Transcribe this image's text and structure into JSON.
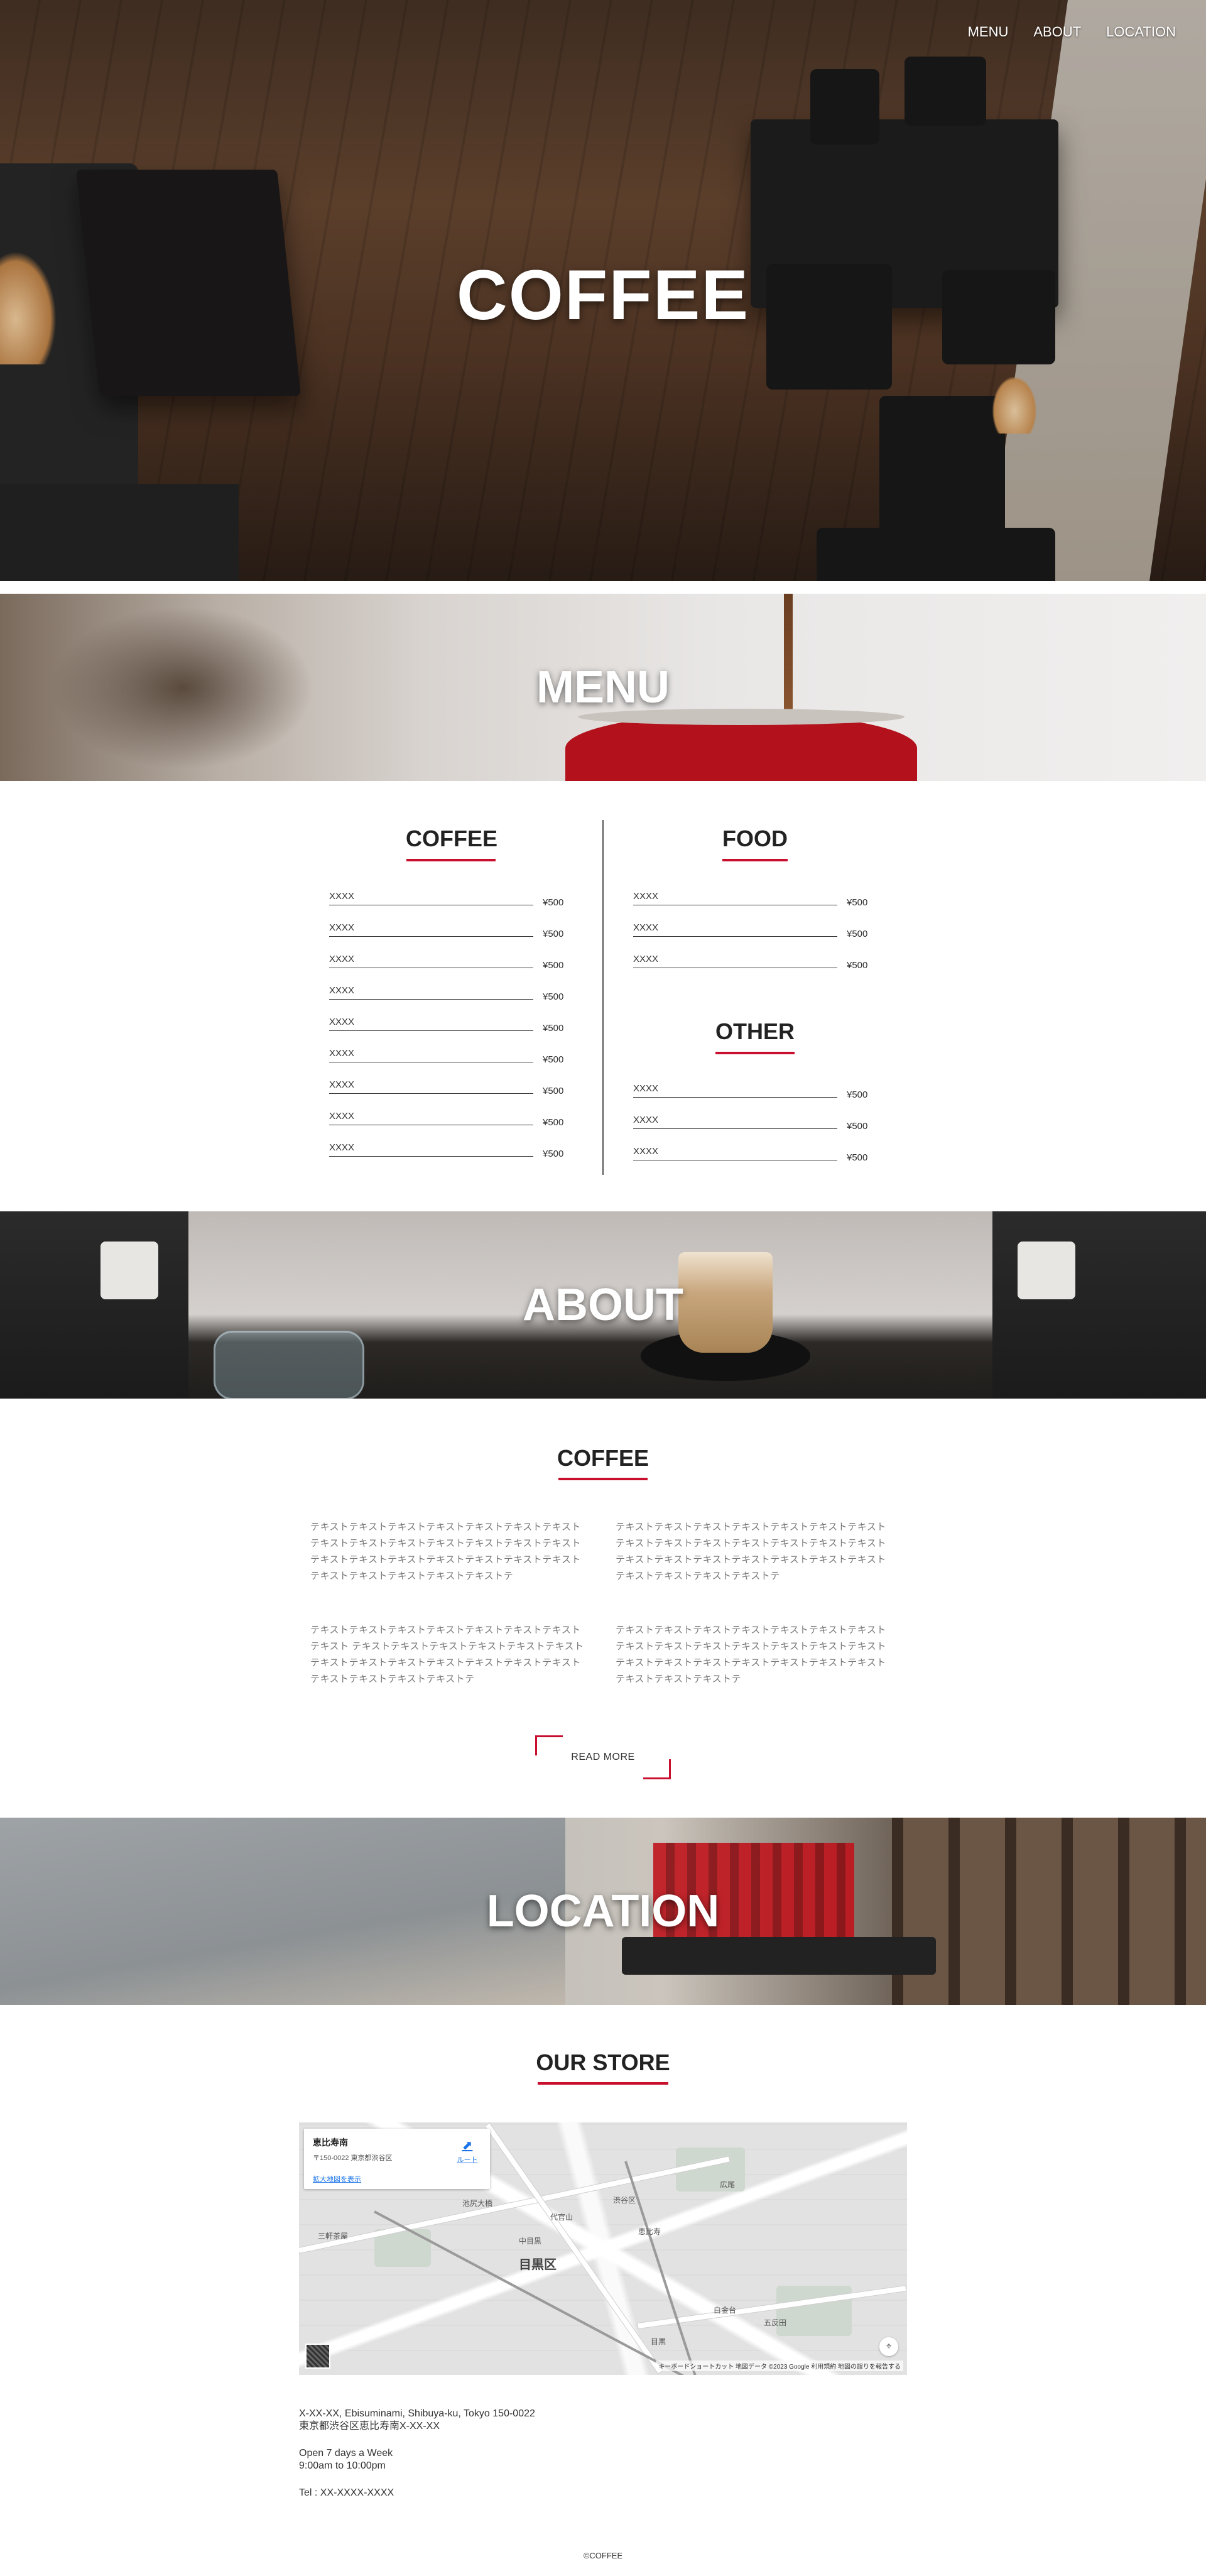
{
  "nav": {
    "items": [
      "MENU",
      "ABOUT",
      "LOCATION"
    ]
  },
  "hero": {
    "title": "COFFEE"
  },
  "banners": {
    "menu": "MENU",
    "about": "ABOUT",
    "location": "LOCATION"
  },
  "menu": {
    "coffee": {
      "title": "COFFEE",
      "items": [
        {
          "name": "XXXX",
          "price": "¥500"
        },
        {
          "name": "XXXX",
          "price": "¥500"
        },
        {
          "name": "XXXX",
          "price": "¥500"
        },
        {
          "name": "XXXX",
          "price": "¥500"
        },
        {
          "name": "XXXX",
          "price": "¥500"
        },
        {
          "name": "XXXX",
          "price": "¥500"
        },
        {
          "name": "XXXX",
          "price": "¥500"
        },
        {
          "name": "XXXX",
          "price": "¥500"
        },
        {
          "name": "XXXX",
          "price": "¥500"
        }
      ]
    },
    "food": {
      "title": "FOOD",
      "items": [
        {
          "name": "XXXX",
          "price": "¥500"
        },
        {
          "name": "XXXX",
          "price": "¥500"
        },
        {
          "name": "XXXX",
          "price": "¥500"
        }
      ]
    },
    "other": {
      "title": "OTHER",
      "items": [
        {
          "name": "XXXX",
          "price": "¥500"
        },
        {
          "name": "XXXX",
          "price": "¥500"
        },
        {
          "name": "XXXX",
          "price": "¥500"
        }
      ]
    }
  },
  "about": {
    "title": "COFFEE",
    "paragraphs": [
      "テキストテキストテキストテキストテキストテキストテキストテキストテキストテキストテキストテキストテキストテキストテキストテキストテキストテキストテキストテキストテキストテキストテキストテキストテキストテキストテ",
      "テキストテキストテキストテキストテキストテキストテキスト テキストテキストテキストテキストテキストテキストテキストテキストテキストテキストテキストテキストテキストテキストテキストテキストテキストテキストテ",
      "テキストテキストテキストテキストテキストテキストテキストテキスト テキストテキストテキストテキストテキストテキストテキストテキストテキストテキストテキストテキストテキストテキストテキストテキストテキストテ",
      "テキストテキストテキストテキストテキストテキストテキスト テキストテキストテキストテキストテキストテキストテキストテキストテキストテキストテキストテキストテキストテキストテキストテキストテキストテ"
    ],
    "read_more": "READ MORE"
  },
  "location": {
    "title": "OUR STORE",
    "map": {
      "card_title": "恵比寿南",
      "card_address": "〒150-0022 東京都渋谷区",
      "card_link": "拡大地図を表示",
      "route_label": "ルート",
      "ward_label": "目黒区",
      "places": [
        "渋谷区",
        "代官山",
        "中目黒",
        "恵比寿",
        "広尾",
        "白金台",
        "目黒",
        "五反田",
        "池尻大橋",
        "三軒茶屋"
      ],
      "footer": "キーボードショートカット  地図データ ©2023 Google  利用規約  地図の誤りを報告する"
    },
    "address_en": "X-XX-XX, Ebisuminami, Shibuya-ku, Tokyo 150-0022",
    "address_jp": "東京都渋谷区恵比寿南X-XX-XX",
    "hours_days": "Open 7 days a Week",
    "hours_time": "9:00am to 10:00pm",
    "tel": "Tel : XX-XXXX-XXXX"
  },
  "footer": {
    "copyright": "©COFFEE"
  },
  "colors": {
    "accent": "#c8102e",
    "text": "#222222",
    "muted": "#777777"
  },
  "icons": {
    "route": "route-arrow-icon",
    "locate": "crosshair-icon"
  }
}
